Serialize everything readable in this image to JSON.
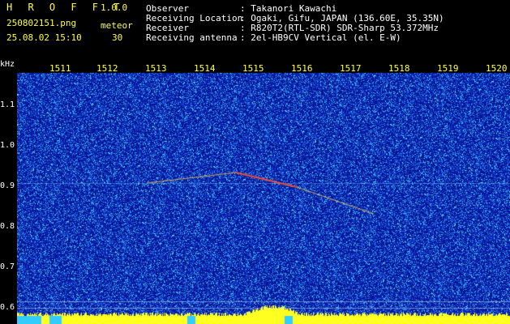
{
  "header": {
    "app_title": "H R O F F T",
    "version": "1.0.0",
    "filename": "250802151.png",
    "mode": "meteor",
    "datetime": "25.08.02 15:10",
    "count": "30",
    "observer_label": "Observer",
    "observer_value": ": Takanori Kawachi",
    "location_label": "Receiving Location",
    "location_value": ": Ogaki, Gifu, JAPAN (136.60E, 35.35N)",
    "receiver_label": "Receiver",
    "receiver_value": ": R820T2(RTL-SDR) SDR-Sharp 53.372MHz",
    "antenna_label": "Receiving antenna",
    "antenna_value": ": 2el-HB9CV Vertical (el. E-W)"
  },
  "axis": {
    "unit": "kHz",
    "y_ticks": [
      "1.1",
      "1.0",
      "0.9",
      "0.8",
      "0.7",
      "0.6"
    ],
    "x_ticks": [
      "1511",
      "1512",
      "1513",
      "1514",
      "1515",
      "1516",
      "1517",
      "1518",
      "1519",
      "1520"
    ]
  },
  "colors": {
    "background": "#0a1f9c",
    "noise_high": "#3ad0ff",
    "meteor_trace": "#ff4030",
    "baseline": "#ffff20",
    "text_yellow": "#ffff44"
  }
}
